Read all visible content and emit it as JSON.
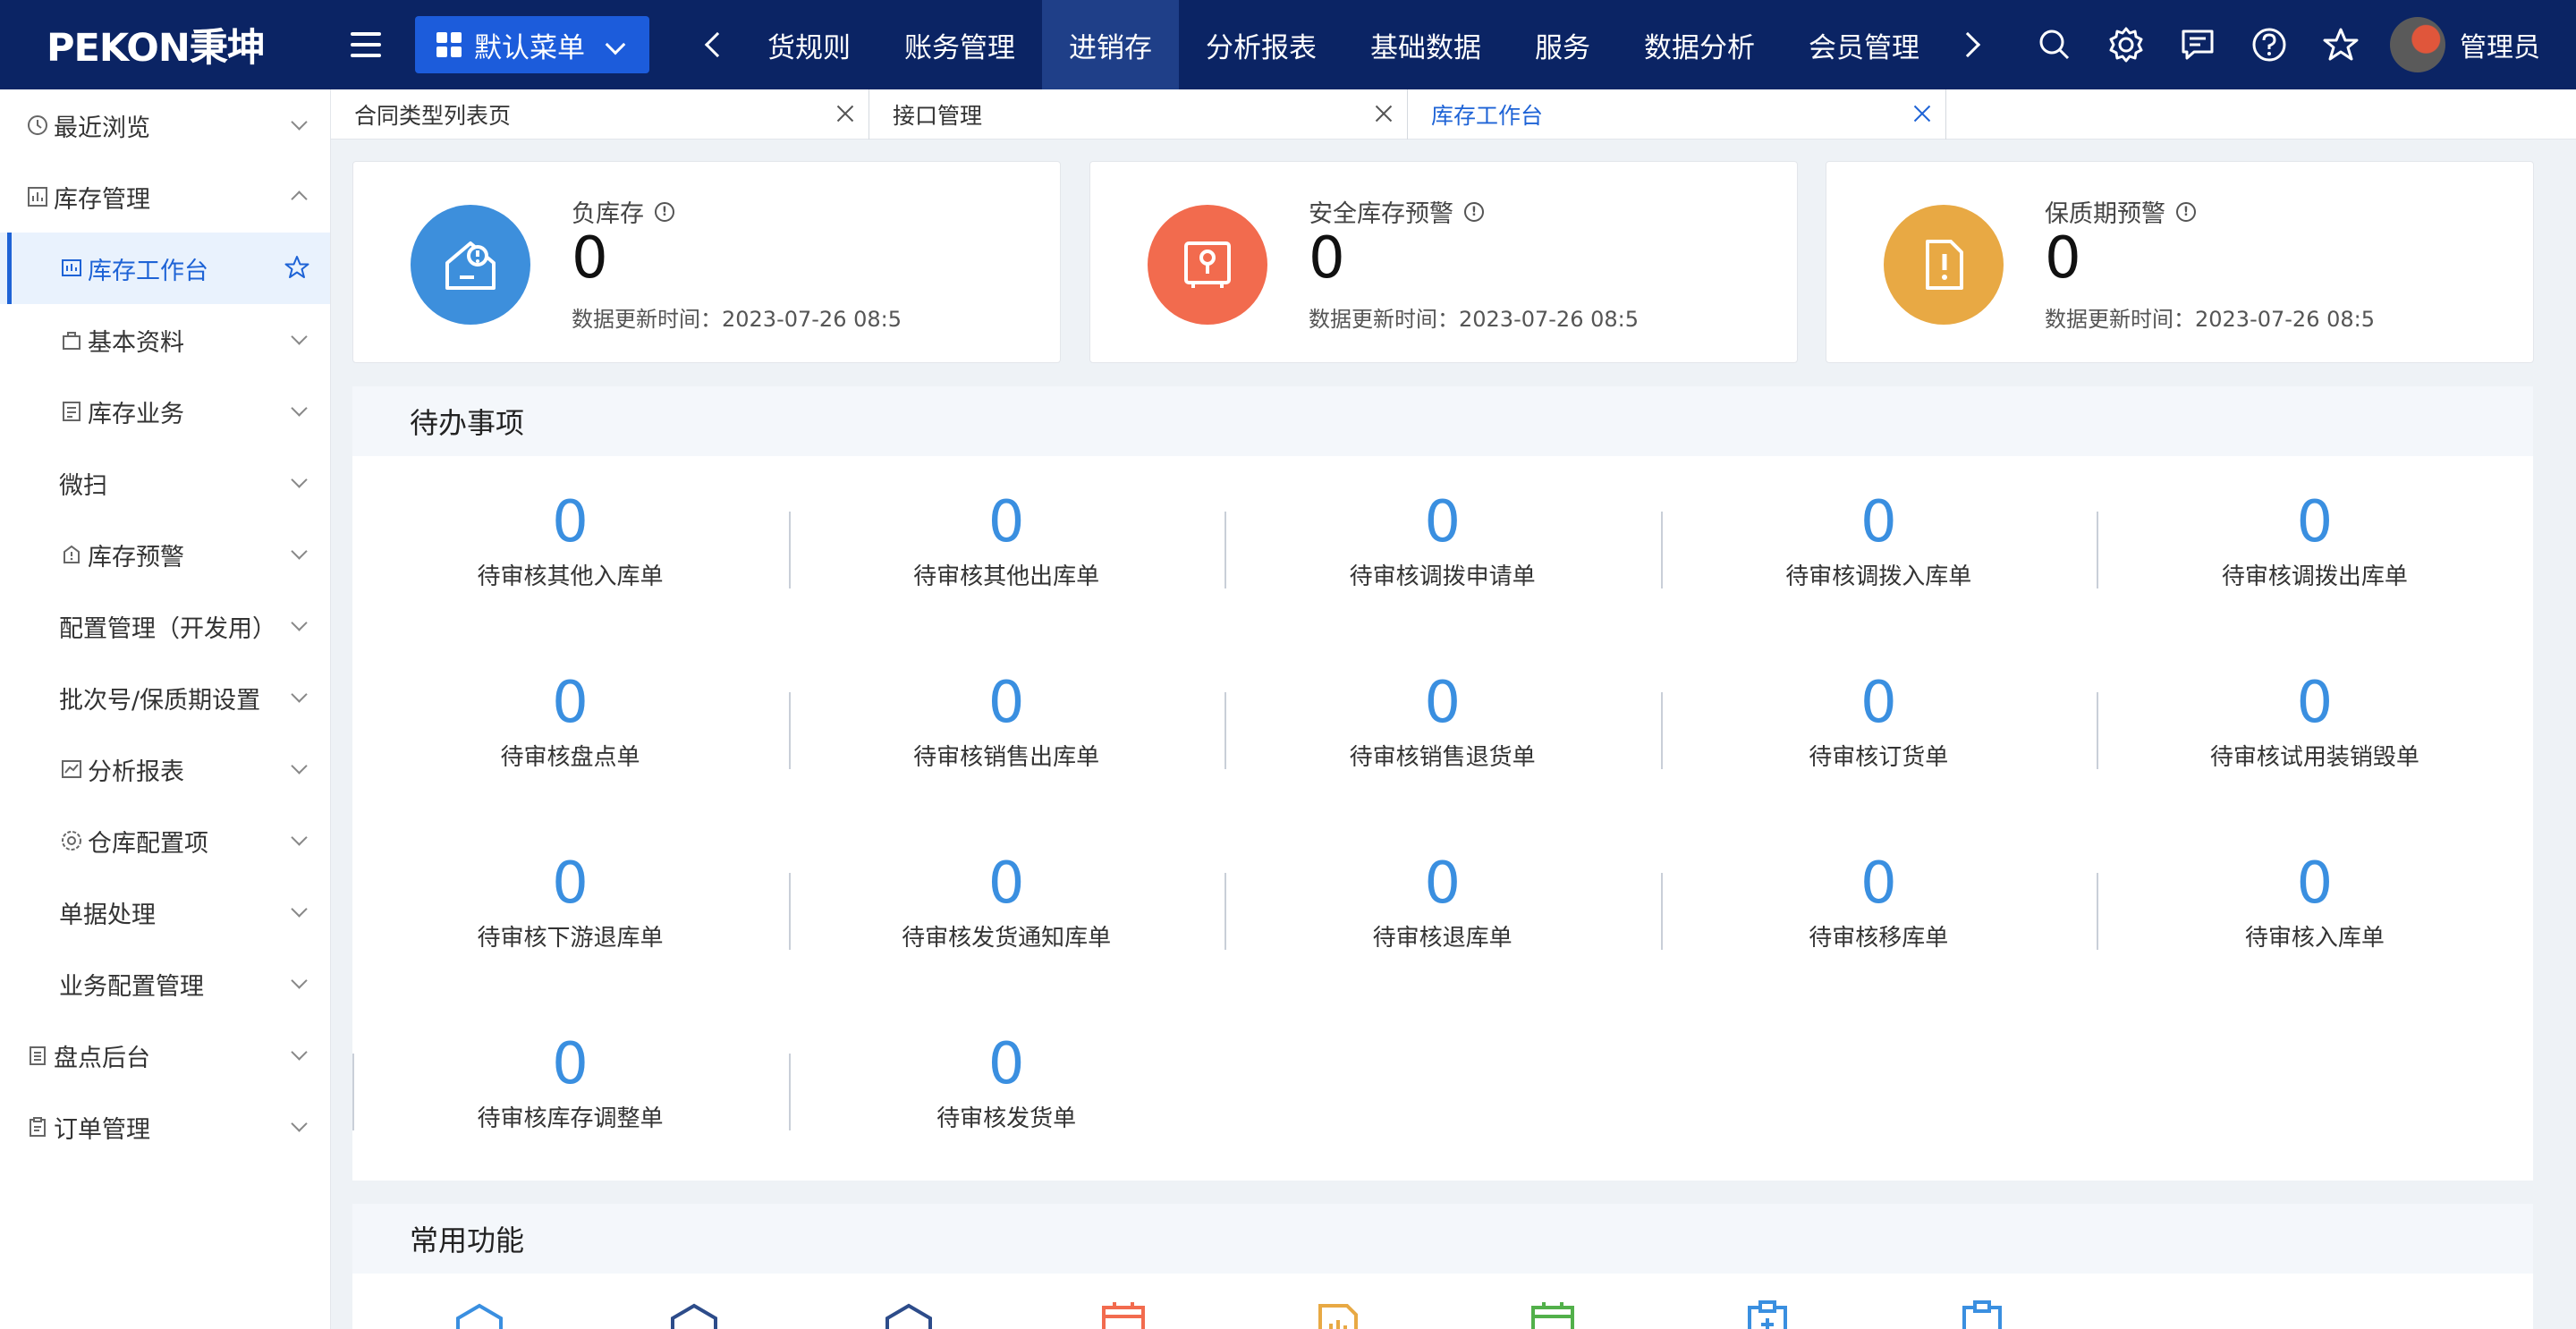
{
  "header": {
    "logo": "PEKON秉坤",
    "menu_select": "默认菜单",
    "nav": [
      "货规则",
      "账务管理",
      "进销存",
      "分析报表",
      "基础数据",
      "服务",
      "数据分析",
      "会员管理"
    ],
    "active_nav": "进销存",
    "username": "管理员"
  },
  "sidebar": {
    "items": [
      {
        "label": "最近浏览",
        "level": 1,
        "icon": "clock-icon"
      },
      {
        "label": "库存管理",
        "level": 1,
        "icon": "chart-icon"
      },
      {
        "label": "库存工作台",
        "level": 2,
        "icon": "dashboard-icon",
        "active": true
      },
      {
        "label": "基本资料",
        "level": 2,
        "icon": "bag-icon"
      },
      {
        "label": "库存业务",
        "level": 2,
        "icon": "document-icon"
      },
      {
        "label": "微扫",
        "level": 2
      },
      {
        "label": "库存预警",
        "level": 2,
        "icon": "warning-icon"
      },
      {
        "label": "配置管理（开发用）",
        "level": 2
      },
      {
        "label": "批次号/保质期设置",
        "level": 2
      },
      {
        "label": "分析报表",
        "level": 2,
        "icon": "report-icon"
      },
      {
        "label": "仓库配置项",
        "level": 2,
        "icon": "gear-icon"
      },
      {
        "label": "单据处理",
        "level": 2
      },
      {
        "label": "业务配置管理",
        "level": 2
      },
      {
        "label": "盘点后台",
        "level": 1,
        "icon": "clipboard-icon"
      },
      {
        "label": "订单管理",
        "level": 1,
        "icon": "order-icon"
      }
    ]
  },
  "tabs": [
    {
      "label": "合同类型列表页"
    },
    {
      "label": "接口管理"
    },
    {
      "label": "库存工作台",
      "active": true
    }
  ],
  "stat_cards": [
    {
      "title": "负库存",
      "value": "0",
      "updated": "数据更新时间：2023-07-26 08:5",
      "color": "#3d8fdc"
    },
    {
      "title": "安全库存预警",
      "value": "0",
      "updated": "数据更新时间：2023-07-26 08:5",
      "color": "#f26b4e"
    },
    {
      "title": "保质期预警",
      "value": "0",
      "updated": "数据更新时间：2023-07-26 08:5",
      "color": "#e8a944"
    }
  ],
  "todo": {
    "title": "待办事项",
    "items": [
      {
        "count": "0",
        "label": "待审核其他入库单"
      },
      {
        "count": "0",
        "label": "待审核其他出库单"
      },
      {
        "count": "0",
        "label": "待审核调拨申请单"
      },
      {
        "count": "0",
        "label": "待审核调拨入库单"
      },
      {
        "count": "0",
        "label": "待审核调拨出库单"
      },
      {
        "count": "0",
        "label": "待审核盘点单"
      },
      {
        "count": "0",
        "label": "待审核销售出库单"
      },
      {
        "count": "0",
        "label": "待审核销售退货单"
      },
      {
        "count": "0",
        "label": "待审核订货单"
      },
      {
        "count": "0",
        "label": "待审核试用装销毁单"
      },
      {
        "count": "0",
        "label": "待审核下游退库单"
      },
      {
        "count": "0",
        "label": "待审核发货通知库单"
      },
      {
        "count": "0",
        "label": "待审核退库单"
      },
      {
        "count": "0",
        "label": "待审核移库单"
      },
      {
        "count": "0",
        "label": "待审核入库单"
      },
      {
        "count": "0",
        "label": "待审核库存调整单"
      },
      {
        "count": "0",
        "label": "待审核发货单"
      }
    ]
  },
  "common": {
    "title": "常用功能"
  }
}
